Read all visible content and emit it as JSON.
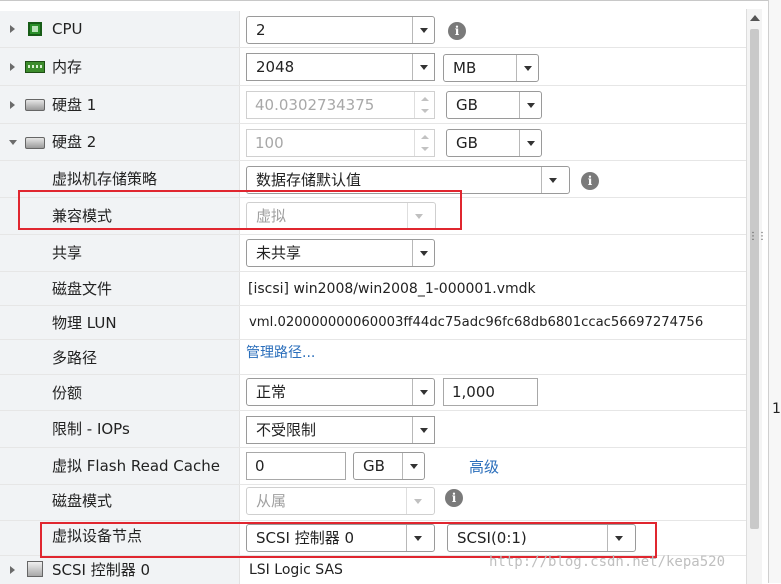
{
  "rows": {
    "cpu": {
      "label": "CPU",
      "value": "2"
    },
    "memory": {
      "label": "内存",
      "value": "2048",
      "unit": "MB"
    },
    "disk1": {
      "label": "硬盘 1",
      "value": "40.0302734375",
      "unit": "GB"
    },
    "disk2": {
      "label": "硬盘 2",
      "value": "100",
      "unit": "GB"
    },
    "storage_policy": {
      "label": "虚拟机存储策略",
      "value": "数据存储默认值"
    },
    "compat_mode": {
      "label": "兼容模式",
      "value": "虚拟"
    },
    "sharing": {
      "label": "共享",
      "value": "未共享"
    },
    "disk_file": {
      "label": "磁盘文件",
      "value": "[iscsi] win2008/win2008_1-000001.vmdk"
    },
    "physical_lun": {
      "label": "物理 LUN",
      "value": "vml.020000000060003ff44dc75adc96fc68db6801ccac56697274756"
    },
    "multipath": {
      "label": "多路径",
      "link": "管理路径..."
    },
    "shares": {
      "label": "份额",
      "value": "正常",
      "number": "1,000"
    },
    "limit_iops": {
      "label": "限制 - IOPs",
      "value": "不受限制"
    },
    "flash_cache": {
      "label": "虚拟 Flash Read Cache",
      "value": "0",
      "unit": "GB",
      "link": "高级"
    },
    "disk_mode": {
      "label": "磁盘模式",
      "value": "从属"
    },
    "device_node": {
      "label": "虚拟设备节点",
      "controller": "SCSI 控制器 0",
      "node": "SCSI(0:1)"
    },
    "scsi_controller": {
      "label": "SCSI 控制器 0",
      "value": "LSI Logic SAS"
    }
  },
  "info_glyph": "i",
  "grip_glyph": "⋮⋮",
  "side_text": "1",
  "watermark": "http://blog.csdn.net/kepa520",
  "colors": {
    "highlight": "#e0262f",
    "link": "#2a6ebb",
    "label_bg": "#f1f3f5"
  },
  "icons": [
    "chevron-right-icon",
    "chevron-down-icon",
    "cpu-icon",
    "memory-icon",
    "disk-icon",
    "scsi-controller-icon",
    "info-icon"
  ]
}
